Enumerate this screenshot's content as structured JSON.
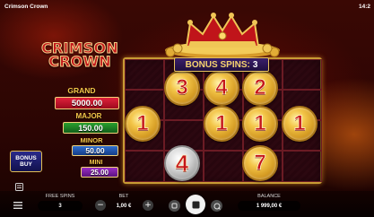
{
  "topbar": {
    "game_title": "Crimson Crown",
    "clock": "14:2"
  },
  "logo": {
    "line1": "CRIMSON",
    "line2": "CROWN"
  },
  "jackpots": {
    "grand": {
      "label": "GRAND",
      "value": "5000.00"
    },
    "major": {
      "label": "MAJOR",
      "value": "150.00"
    },
    "minor": {
      "label": "MINOR",
      "value": "50.00"
    },
    "mini": {
      "label": "MINI",
      "value": "25.00"
    }
  },
  "bonus_spins": {
    "label": "BONUS SPINS:",
    "value": "3"
  },
  "bonus_buy": {
    "line1": "BONUS",
    "line2": "BUY"
  },
  "coins": [
    {
      "value": "3"
    },
    {
      "value": "4"
    },
    {
      "value": "2"
    },
    {
      "value": "1"
    },
    {
      "value": "1"
    },
    {
      "value": "1"
    },
    {
      "value": "1"
    },
    {
      "value": "1"
    },
    {
      "value": "4"
    },
    {
      "value": "7"
    }
  ],
  "bottom": {
    "free_spins_label": "FREE SPINS",
    "free_spins_value": "3",
    "bet_label": "BET",
    "bet_value": "1,00 €",
    "balance_label": "BALANCE",
    "balance_value": "1 999,00 €",
    "minus": "−",
    "plus": "+"
  },
  "colors": {
    "grand": "#c8102e",
    "major": "#1b7a1f",
    "minor": "#1f4fa8",
    "mini": "#7a1fa0",
    "accent_gold": "#e6c15b"
  }
}
